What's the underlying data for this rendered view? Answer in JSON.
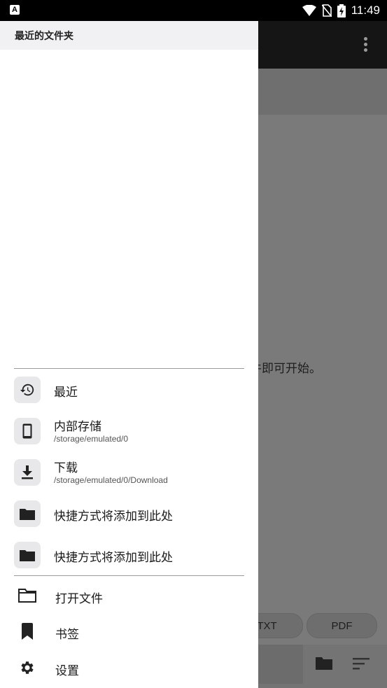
{
  "status_bar": {
    "app_badge": "A",
    "time": "11:49"
  },
  "drawer": {
    "header_title": "最近的文件夹",
    "locations": [
      {
        "title": "最近",
        "icon": "history-icon"
      },
      {
        "title": "内部存储",
        "path": "/storage/emulated/0",
        "icon": "phone-icon"
      },
      {
        "title": "下载",
        "path": "/storage/emulated/0/Download",
        "icon": "download-icon"
      },
      {
        "title": "快捷方式将添加到此处",
        "icon": "folder-icon"
      },
      {
        "title": "快捷方式将添加到此处",
        "icon": "folder-icon"
      }
    ],
    "actions": [
      {
        "label": "打开文件",
        "icon": "folder-outline-icon"
      },
      {
        "label": "书签",
        "icon": "bookmark-icon"
      },
      {
        "label": "设置",
        "icon": "gear-icon"
      }
    ]
  },
  "background": {
    "hint_text": "件即可开始。",
    "chips": [
      "TXT",
      "PDF"
    ]
  }
}
